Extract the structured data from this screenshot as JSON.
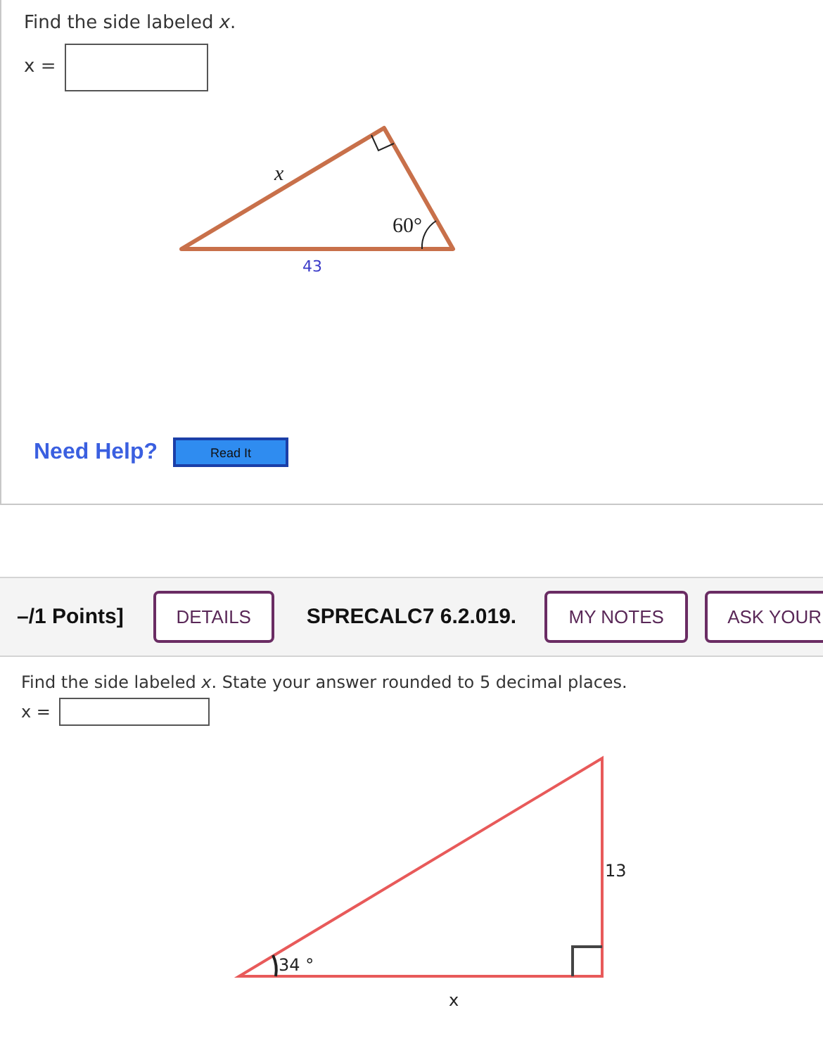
{
  "question_1": {
    "prompt": "Find the side labeled *x*.",
    "answer": {
      "label": "x ="
    },
    "diagram": {
      "side_label": "x",
      "angle_label": "60°",
      "base_label": "43"
    },
    "help": {
      "label": "Need Help?",
      "button": "Read It"
    }
  },
  "header": {
    "items": [
      {
        "kind": "text",
        "text": "–/1 Points]"
      },
      {
        "kind": "button",
        "text": "DETAILS"
      },
      {
        "kind": "text",
        "text": "SPRECALC7 6.2.019."
      },
      {
        "kind": "button",
        "text": "MY NOTES"
      },
      {
        "kind": "button",
        "text": "ASK YOUR"
      }
    ]
  },
  "question_2": {
    "prompt": "Find the side labeled *x*. State your answer rounded to 5 decimal places.",
    "answer": {
      "label": "x ="
    },
    "diagram": {
      "angle_label": "34 °",
      "side_label": "13",
      "base_label": "x"
    }
  }
}
